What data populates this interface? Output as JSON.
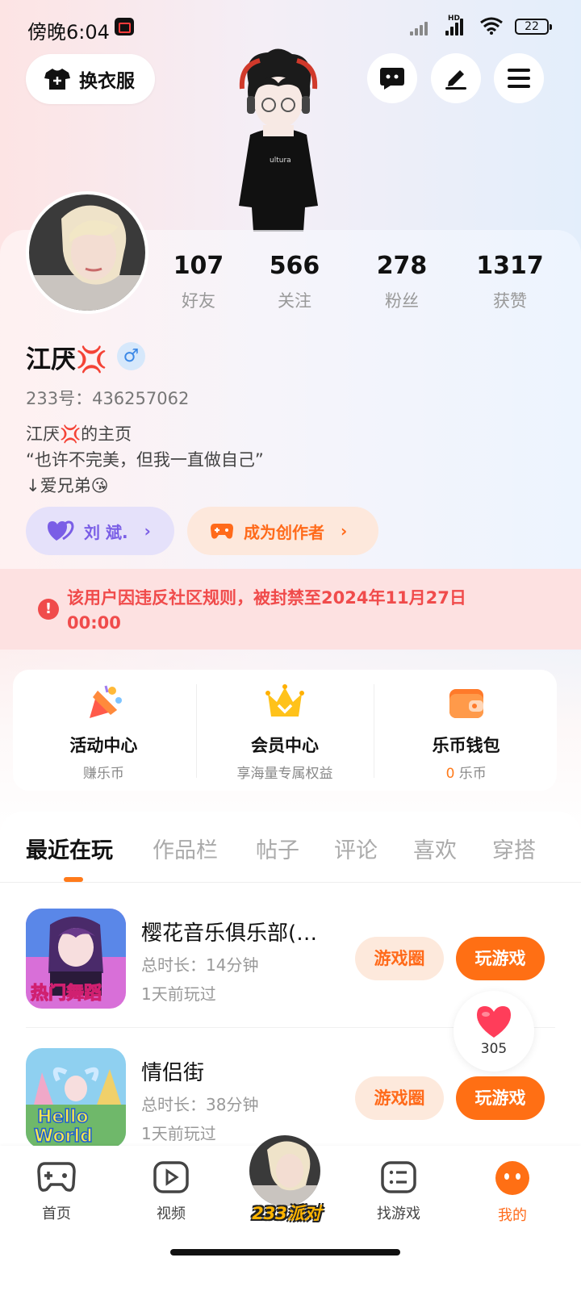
{
  "status_bar": {
    "time": "傍晚6:04",
    "network": "HD",
    "battery": "22"
  },
  "top_bar": {
    "outfit_label": "换衣服"
  },
  "stats": [
    {
      "value": "107",
      "label": "好友"
    },
    {
      "value": "566",
      "label": "关注"
    },
    {
      "value": "278",
      "label": "粉丝"
    },
    {
      "value": "1317",
      "label": "获赞"
    }
  ],
  "profile": {
    "nickname": "江厌💢",
    "gender_symbol": "♂",
    "uid": "233号：436257062",
    "bio": [
      "江厌💢的主页",
      "“也许不完美，但我一直做自己”",
      "↓爱兄弟😘"
    ],
    "cp_name": "刘 斌.",
    "creator_label": "成为创作者"
  },
  "ban_notice": "该用户因违反社区规则，被封禁至2024年11月27日 00:00",
  "services": [
    {
      "title": "活动中心",
      "sub": "赚乐币"
    },
    {
      "title": "会员中心",
      "sub": "享海量专属权益"
    },
    {
      "title": "乐币钱包",
      "sub_value": "0",
      "sub_unit": " 乐币"
    }
  ],
  "tabs": [
    "最近在玩",
    "作品栏",
    "帖子",
    "评论",
    "喜欢",
    "穿搭"
  ],
  "games": [
    {
      "name": "樱花音乐俱乐部(…",
      "duration": "总时长：14分钟",
      "last_played": "1天前玩过",
      "thumb_text": "热门舞蹈",
      "circle_label": "游戏圈",
      "play_label": "玩游戏"
    },
    {
      "name": "情侣街",
      "duration": "总时长：38分钟",
      "last_played": "1天前玩过",
      "thumb_text": "Hello World",
      "circle_label": "游戏圈",
      "play_label": "玩游戏"
    }
  ],
  "like_count": "305",
  "bottom_nav": [
    {
      "label": "首页"
    },
    {
      "label": "视频"
    },
    {
      "label": "233派对"
    },
    {
      "label": "找游戏"
    },
    {
      "label": "我的"
    }
  ],
  "colors": {
    "accent": "#ff6f14",
    "ban_red": "#f04b4b",
    "cp_purple": "#7a5ee6"
  }
}
